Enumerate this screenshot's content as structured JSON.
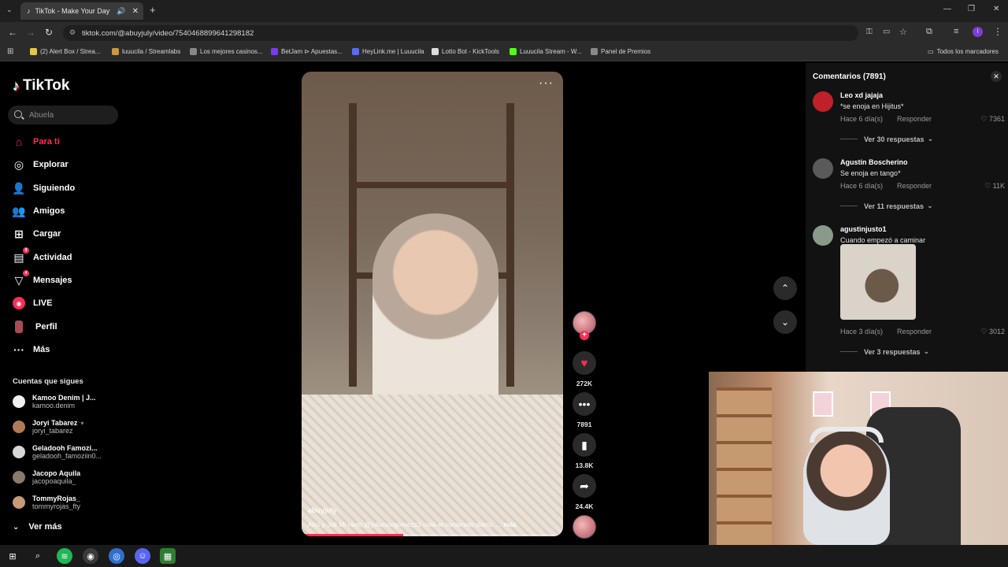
{
  "browser": {
    "tab_title": "TikTok - Make Your Day",
    "url": "tiktok.com/@abuyjuly/video/7540468899641298182",
    "bookmarks": [
      {
        "label": "(2) Alert Box / Strea...",
        "color": "#e3c74a"
      },
      {
        "label": "luuucila / Streamlabs",
        "color": "#c79a40"
      },
      {
        "label": "Los mejores casinos...",
        "color": "#888888"
      },
      {
        "label": "BetJam ⊳ Apuestas...",
        "color": "#7c3aed"
      },
      {
        "label": "HeyLink.me | Luuucila",
        "color": "#5b6bf0"
      },
      {
        "label": "Lotto Bot - KickTools",
        "color": "#dddddd"
      },
      {
        "label": "Luuucila Stream - W...",
        "color": "#53fc18"
      },
      {
        "label": "Panel de Premios",
        "color": "#888888"
      }
    ],
    "all_bookmarks": "Todos los marcadores"
  },
  "sidebar": {
    "logo": "TikTok",
    "search_placeholder": "Abuela",
    "nav": [
      {
        "label": "Para ti",
        "icon": "home-icon"
      },
      {
        "label": "Explorar",
        "icon": "compass-icon"
      },
      {
        "label": "Siguiendo",
        "icon": "following-icon"
      },
      {
        "label": "Amigos",
        "icon": "friends-icon"
      },
      {
        "label": "Cargar",
        "icon": "upload-icon"
      },
      {
        "label": "Actividad",
        "icon": "activity-icon",
        "badge": "8"
      },
      {
        "label": "Mensajes",
        "icon": "messages-icon",
        "badge": "4"
      },
      {
        "label": "LIVE",
        "icon": "live-icon"
      },
      {
        "label": "Perfil",
        "icon": "profile-icon"
      },
      {
        "label": "Más",
        "icon": "more-icon"
      }
    ],
    "following_title": "Cuentas que sigues",
    "following": [
      {
        "name": "Kamoo Denim | J...",
        "user": "kamoo.denim",
        "color": "#f0f0f0"
      },
      {
        "name": "Joryi Tabarez ♆",
        "user": "joryi_tabarez",
        "color": "#b07a58"
      },
      {
        "name": "Geladooh Famozi...",
        "user": "geladooh_famoziin0...",
        "color": "#d7d7d7"
      },
      {
        "name": "Jacopo Aquila",
        "user": "jacopoaquila_",
        "color": "#8a7a6a"
      },
      {
        "name": "TommyRojas_",
        "user": "tommyrojas_fty",
        "color": "#c89a7a"
      }
    ],
    "see_more": "Ver más"
  },
  "video": {
    "author": "abuyjuly",
    "description": "Abu y Juli   Mi nieto @julianoogomezz3  crea el contenido diario.  ...",
    "more": "más",
    "progress": 0.39
  },
  "actions": {
    "likes": "272K",
    "comments": "7891",
    "saves": "13.8K",
    "shares": "24.4K"
  },
  "comments_panel": {
    "title": "Comentarios (7891)",
    "items": [
      {
        "user": "Leo xd jajaja",
        "text": "*se enoja en Hijitus*",
        "time": "Hace 6 día(s)",
        "reply": "Responder",
        "likes": "7361",
        "replies": "Ver 30 respuestas",
        "avatar_color": "#c0202a"
      },
      {
        "user": "Agustín Boscherino",
        "text": "Se enoja en tango*",
        "time": "Hace 6 día(s)",
        "reply": "Responder",
        "likes": "11K",
        "replies": "Ver 11 respuestas",
        "avatar_color": "#5a5a5a"
      },
      {
        "user": "agustinjusto1",
        "text": "Cuando empezó a caminar",
        "time": "Hace 3 día(s)",
        "reply": "Responder",
        "likes": "3012",
        "replies": "Ver 3 respuestas",
        "avatar_color": "#8a9a8a"
      }
    ]
  }
}
